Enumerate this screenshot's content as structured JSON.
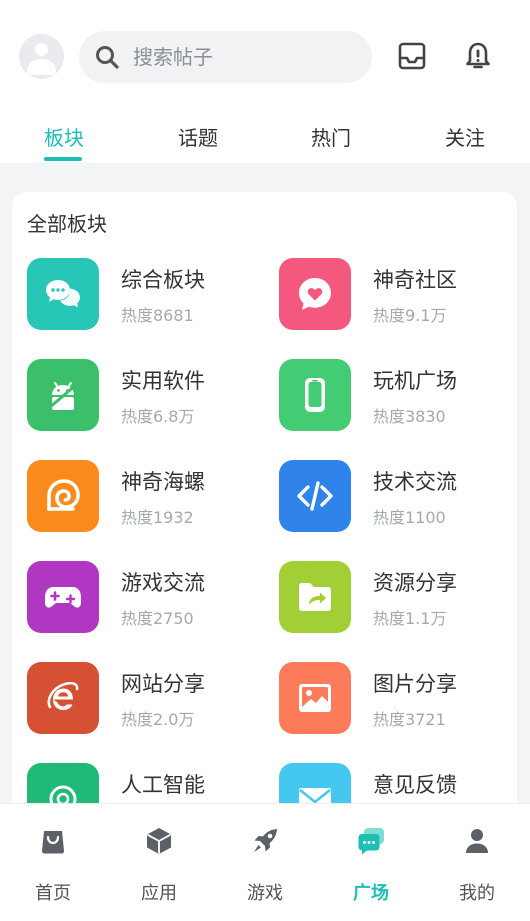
{
  "header": {
    "search_placeholder": "搜索帖子"
  },
  "tabs": [
    {
      "label": "板块",
      "active": true
    },
    {
      "label": "话题",
      "active": false
    },
    {
      "label": "热门",
      "active": false
    },
    {
      "label": "关注",
      "active": false
    }
  ],
  "section": {
    "title": "全部板块"
  },
  "boards": [
    {
      "name": "综合板块",
      "heat": "热度8681",
      "icon": "chat-bubbles-icon",
      "color": "#27c6b7"
    },
    {
      "name": "神奇社区",
      "heat": "热度9.1万",
      "icon": "heart-bubble-icon",
      "color": "#f4587f"
    },
    {
      "name": "实用软件",
      "heat": "热度6.8万",
      "icon": "android-icon",
      "color": "#3cbf6a"
    },
    {
      "name": "玩机广场",
      "heat": "热度3830",
      "icon": "phone-icon",
      "color": "#43cc74"
    },
    {
      "name": "神奇海螺",
      "heat": "热度1932",
      "icon": "conch-icon",
      "color": "#fb8a1c"
    },
    {
      "name": "技术交流",
      "heat": "热度1100",
      "icon": "code-icon",
      "color": "#2f83eb"
    },
    {
      "name": "游戏交流",
      "heat": "热度2750",
      "icon": "gamepad-icon",
      "color": "#b037c2"
    },
    {
      "name": "资源分享",
      "heat": "热度1.1万",
      "icon": "folder-share-icon",
      "color": "#a3cf36"
    },
    {
      "name": "网站分享",
      "heat": "热度2.0万",
      "icon": "browser-icon",
      "color": "#d65033"
    },
    {
      "name": "图片分享",
      "heat": "热度3721",
      "icon": "image-icon",
      "color": "#fb7b5b"
    },
    {
      "name": "人工智能",
      "heat": "",
      "icon": "ai-icon",
      "color": "#20b978"
    },
    {
      "name": "意见反馈",
      "heat": "",
      "icon": "mail-icon",
      "color": "#44c8f0"
    }
  ],
  "bottom_nav": [
    {
      "label": "首页",
      "icon": "bag-icon",
      "active": false
    },
    {
      "label": "应用",
      "icon": "cube-icon",
      "active": false
    },
    {
      "label": "游戏",
      "icon": "rocket-icon",
      "active": false
    },
    {
      "label": "广场",
      "icon": "square-chat-icon",
      "active": true
    },
    {
      "label": "我的",
      "icon": "user-icon",
      "active": false
    }
  ],
  "colors": {
    "accent": "#1bbfb4",
    "inactive_icon": "#5c6168"
  }
}
